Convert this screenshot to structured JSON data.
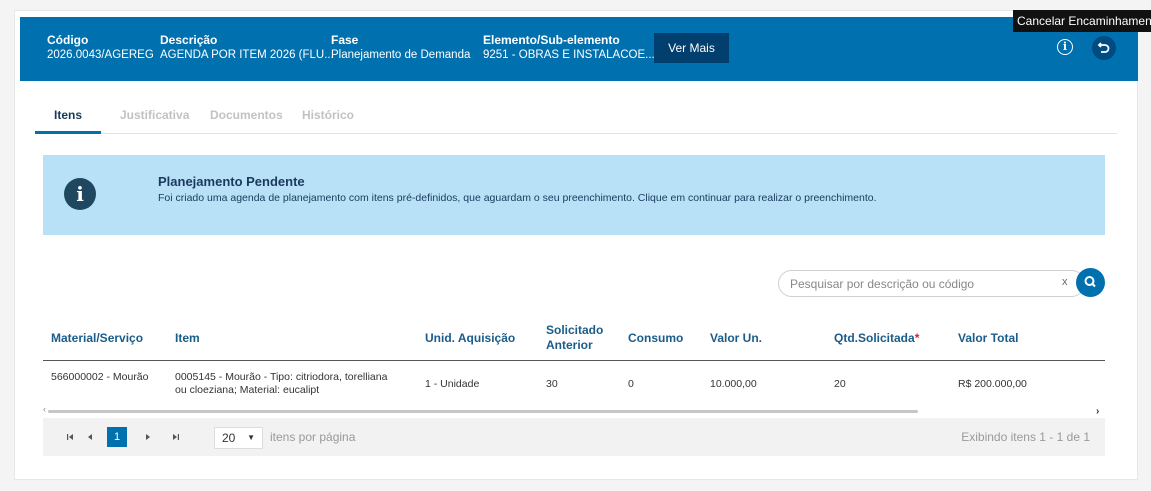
{
  "header": {
    "codigo_label": "Código",
    "codigo_value": "2026.0043/AGEREG",
    "descricao_label": "Descrição",
    "descricao_value": "AGENDA POR ITEM 2026 (FLU...",
    "fase_label": "Fase",
    "fase_value": "Planejamento de Demanda",
    "elemento_label": "Elemento/Sub-elemento",
    "elemento_value": "9251 - OBRAS E INSTALACOE...",
    "ver_mais_label": "Ver Mais",
    "tooltip": "Cancelar Encaminhamento"
  },
  "tabs": [
    {
      "label": "Itens",
      "active": true
    },
    {
      "label": "Justificativa"
    },
    {
      "label": "Documentos"
    },
    {
      "label": "Histórico"
    }
  ],
  "alert": {
    "title": "Planejamento Pendente",
    "text": "Foi criado uma agenda de planejamento com itens pré-definidos, que aguardam o seu preenchimento. Clique em continuar para realizar o preenchimento."
  },
  "search": {
    "placeholder": "Pesquisar por descrição ou código",
    "clear": "x"
  },
  "table": {
    "headers": {
      "material": "Material/Serviço",
      "item": "Item",
      "unid": "Unid. Aquisição",
      "solicitado": "Solicitado Anterior",
      "consumo": "Consumo",
      "valor_un": "Valor Un.",
      "qtd": "Qtd.Solicitada",
      "qtd_required": "*",
      "valor_total": "Valor Total"
    },
    "rows": [
      {
        "material": "566000002 - Mourão",
        "item": "0005145 - Mourão - Tipo: citriodora, torelliana ou cloeziana; Material: eucalipt",
        "unid": "1 - Unidade",
        "solicitado": "30",
        "consumo": "0",
        "valor_un": "10.000,00",
        "qtd": "20",
        "valor_total": "R$ 200.000,00"
      }
    ]
  },
  "pager": {
    "first": "⏮",
    "prev": "◀",
    "current_page": "1",
    "next": "▶",
    "last": "⏭",
    "page_size": "20",
    "per_page_label": "itens por página",
    "showing": "Exibindo itens 1 - 1 de 1"
  },
  "colors": {
    "header_bg": "#0070ae",
    "alert_bg": "#b8e0f7",
    "accent": "#0070ae"
  }
}
